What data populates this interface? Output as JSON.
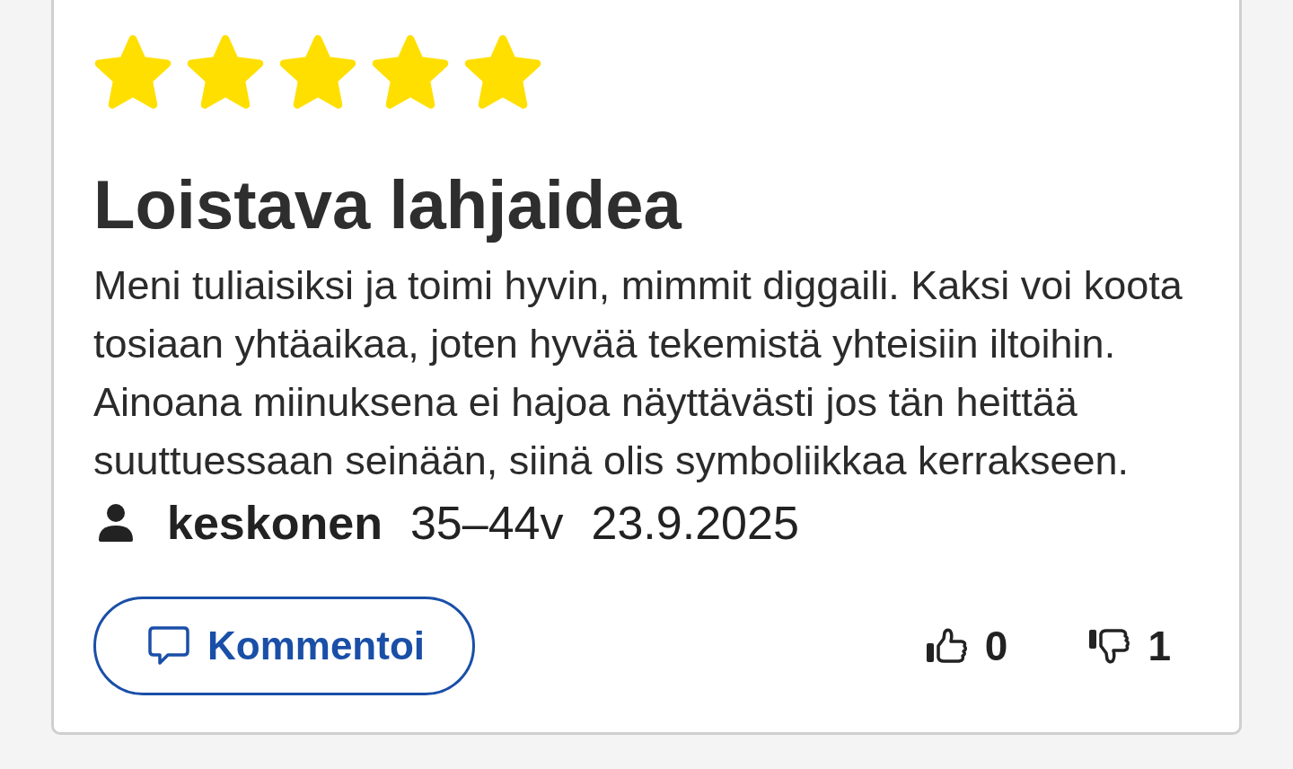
{
  "review": {
    "stars": 5,
    "title": "Loistava lahjaidea",
    "text": "Meni tuliaisiksi ja toimi hyvin, mimmit diggaili. Kaksi voi koota tosiaan yhtäaikaa, joten hyvää tekemistä yhteisiin iltoihin. Ainoana miinuksena ei hajoa näyttävästi jos tän heittää suuttuessaan seinään, siinä olis symboliikkaa kerrakseen.",
    "author": {
      "name": "keskonen",
      "age_group": "35–44v",
      "date": "23.9.2025"
    },
    "comment_button": "Kommentoi",
    "votes": {
      "up": "0",
      "down": "1"
    }
  }
}
